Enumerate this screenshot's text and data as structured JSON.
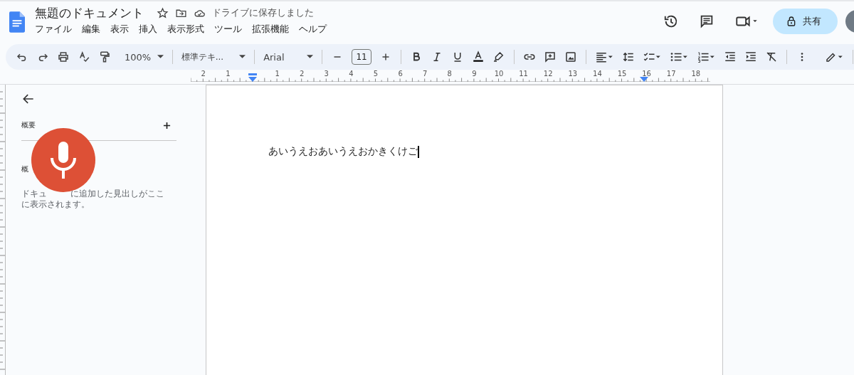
{
  "title": "無題のドキュメント",
  "save_status": "ドライブに保存しました",
  "menu": [
    "ファイル",
    "編集",
    "表示",
    "挿入",
    "表示形式",
    "ツール",
    "拡張機能",
    "ヘルプ"
  ],
  "share_button": "共有",
  "toolbar": {
    "zoom": "100%",
    "style": "標準テキ...",
    "font": "Arial",
    "font_size": "11"
  },
  "ruler": {
    "left_labels": [
      "2",
      "1"
    ],
    "right_labels": [
      "1",
      "2",
      "3",
      "4",
      "5",
      "6",
      "7",
      "8",
      "9",
      "10",
      "11",
      "12",
      "13",
      "14",
      "15",
      "16",
      "17",
      "18"
    ]
  },
  "outline": {
    "heading": "概要",
    "second_heading": "概",
    "hint_parts": [
      "ドキュ",
      "に追加した見出しがここ",
      "に表示されます。"
    ]
  },
  "document": {
    "text": "あいうえおあいうえおかきくけご",
    "cursor": true
  }
}
